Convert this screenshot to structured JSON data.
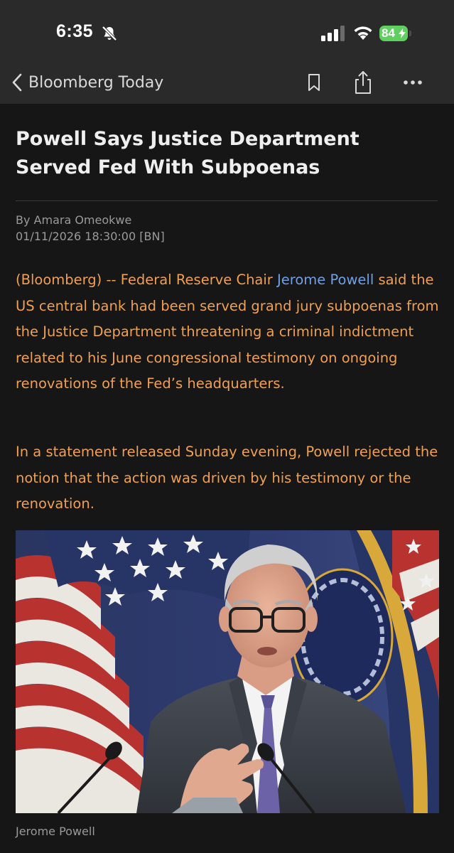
{
  "status_bar": {
    "time": "6:35",
    "battery": "84"
  },
  "nav": {
    "back_label": "Bloomberg Today"
  },
  "article": {
    "headline": "Powell Says Justice Department Served Fed With Subpoenas",
    "byline": "By Amara Omeokwe",
    "timestamp": "01/11/2026 18:30:00 [BN]",
    "para1_prefix": "(Bloomberg) -- Federal Reserve Chair ",
    "para1_link": "Jerome Powell",
    "para1_suffix": " said the US central bank had been served grand jury subpoenas from the Justice Department threatening a criminal indictment related to his June congressional testimony on ongoing renovations of the Fed’s headquarters.",
    "para2": "In a statement released Sunday evening, Powell rejected the notion that the action was driven by his testimony or the renovation.",
    "photo_caption": "Jerome Powell"
  },
  "colors": {
    "body_text": "#f0a050",
    "link": "#6fa0e8",
    "background": "#161616",
    "chrome": "#2a2a2a",
    "battery": "#5fcf5f"
  },
  "icons": [
    "bell-slash-icon",
    "cellular-signal-icon",
    "wifi-icon",
    "battery-icon",
    "chevron-left-icon",
    "bookmark-icon",
    "share-icon",
    "more-icon"
  ]
}
